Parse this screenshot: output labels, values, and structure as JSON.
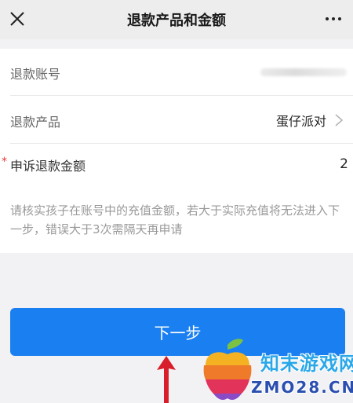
{
  "header": {
    "title": "退款产品和金额"
  },
  "form": {
    "account": {
      "label": "退款账号"
    },
    "product": {
      "label": "退款产品",
      "value": "蛋仔派对"
    },
    "amount": {
      "required_mark": "*",
      "label": "申诉退款金额",
      "value": "2"
    },
    "hint": "请核实孩子在账号中的充值金额，若大于实际充值将无法进入下一步，错误大于3次需隔天再申请"
  },
  "actions": {
    "next_label": "下一步"
  },
  "watermark": {
    "site_name": "知末游戏网",
    "domain": "ZMO28.CN"
  },
  "colors": {
    "primary": "#1a7ff0",
    "required": "#e53935",
    "arrow": "#d81e2a"
  },
  "icons": {
    "close": "close-icon",
    "more": "more-dots-icon",
    "chevron": "chevron-right-icon",
    "arrow": "up-arrow-icon"
  }
}
